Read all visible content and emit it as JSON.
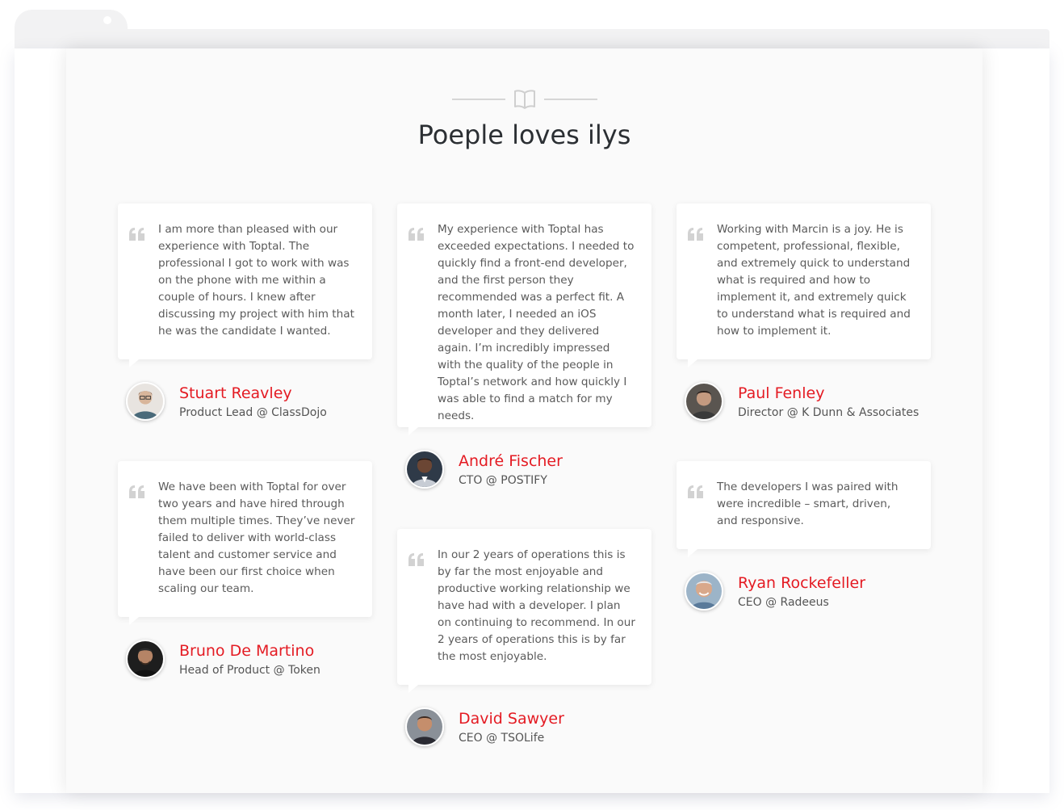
{
  "page": {
    "title": "Poeple loves ilys"
  },
  "icons": {
    "header": "book-open-icon",
    "quote": "quote-icon"
  },
  "colors": {
    "accent": "#e41b23",
    "background": "#fafafa",
    "card": "#ffffff",
    "text": "#5a5a5a"
  },
  "testimonials": [
    {
      "quote": "I am more than pleased with our experience with Toptal. The professional I got to work with was on the phone with me within a couple of hours. I knew after discussing my project with him that he was the candidate I wanted.",
      "name": "Stuart Reavley",
      "role": "Product Lead @ ClassDojo"
    },
    {
      "quote": "We have been with Toptal for over two years and have hired through them multiple times. They’ve never failed to deliver with world-class talent and customer service and have been our first choice when scaling our team.",
      "name": "Bruno De Martino",
      "role": "Head of Product @ Token"
    },
    {
      "quote": "My experience with Toptal has exceeded expectations. I needed to quickly find a front-end developer, and the first person they recommended was a perfect fit. A month later, I needed an iOS developer and they delivered again. I’m incredibly impressed with the quality of the people in Toptal’s network and how quickly I was able to find a match for my needs.",
      "name": "André Fischer",
      "role": "CTO @ POSTIFY"
    },
    {
      "quote": "In our 2 years of operations this is by far the most enjoyable and productive working relationship we have had with a developer. I plan on continuing to recommend. In our 2 years of operations this is by far the most enjoyable.",
      "name": "David Sawyer",
      "role": "CEO @ TSOLife"
    },
    {
      "quote": "Working with Marcin is a joy. He is competent, professional, flexible, and extremely quick to understand what is required and how to implement it, and extremely quick to understand what is required and how to implement it.",
      "name": "Paul Fenley",
      "role": "Director @ K Dunn & Associates"
    },
    {
      "quote": "The developers I was paired with were incredible – smart, driven, and responsive.",
      "name": "Ryan Rockefeller",
      "role": "CEO @ Radeeus"
    }
  ]
}
